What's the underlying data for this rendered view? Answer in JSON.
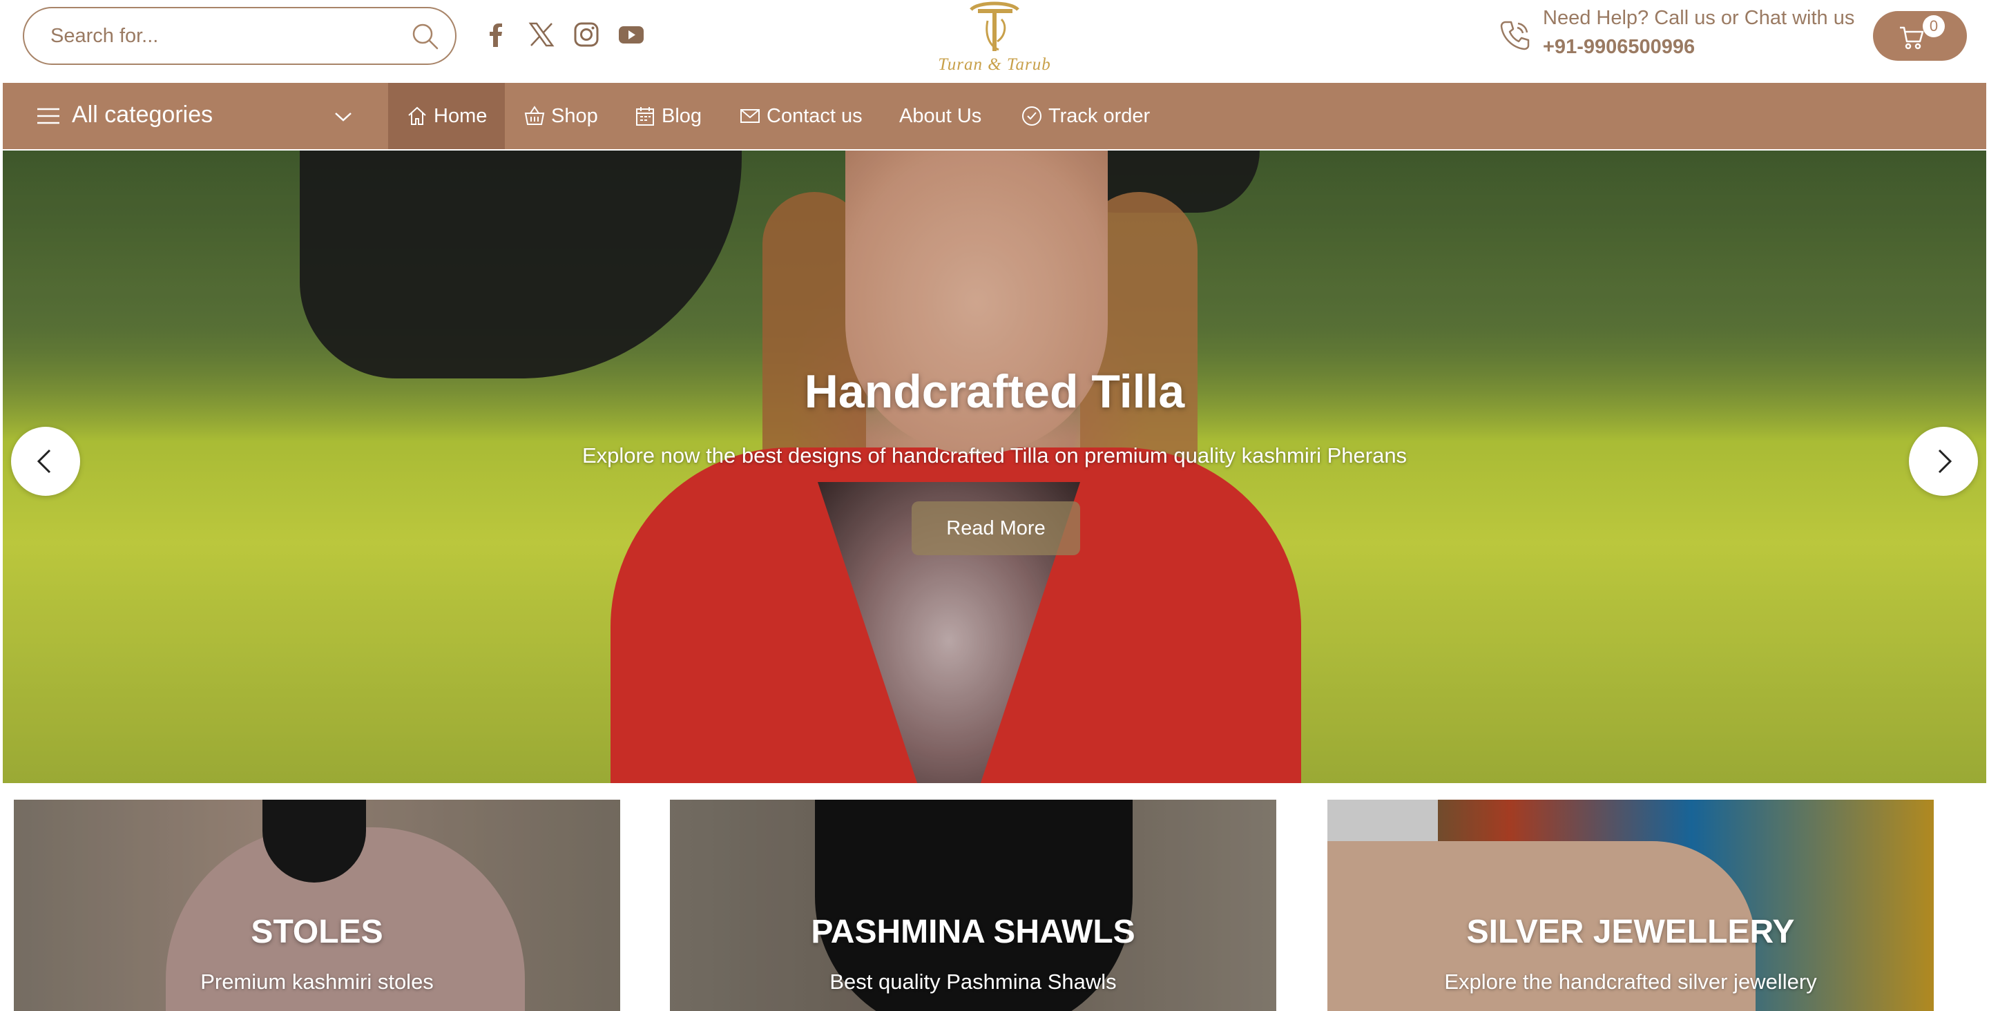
{
  "search": {
    "placeholder": "Search for..."
  },
  "social": [
    "facebook-icon",
    "x-twitter-icon",
    "instagram-icon",
    "youtube-icon"
  ],
  "logo": {
    "brand": "Turan & Tarub"
  },
  "help": {
    "line1": "Need Help? Call us or Chat with us",
    "phone": "+91-9906500996"
  },
  "cart": {
    "count": "0"
  },
  "nav": {
    "all_categories": "All categories",
    "items": [
      {
        "label": "Home",
        "icon": "home-icon",
        "active": true
      },
      {
        "label": "Shop",
        "icon": "basket-icon"
      },
      {
        "label": "Blog",
        "icon": "calendar-icon"
      },
      {
        "label": "Contact us",
        "icon": "mail-icon"
      },
      {
        "label": "About Us"
      },
      {
        "label": "Track order",
        "icon": "check-circle-icon"
      }
    ]
  },
  "hero": {
    "title": "Handcrafted Tilla",
    "subtitle": "Explore now the best designs of handcrafted Tilla on premium quality kashmiri Pherans",
    "button": "Read More"
  },
  "categories": [
    {
      "title": "STOLES",
      "subtitle": "Premium kashmiri stoles"
    },
    {
      "title": "PASHMINA SHAWLS",
      "subtitle": "Best quality Pashmina Shawls"
    },
    {
      "title": "SILVER JEWELLERY",
      "subtitle": "Explore the handcrafted silver jewellery"
    }
  ],
  "colors": {
    "brand": "#ae7f62",
    "brand_dark": "#96684e",
    "text": "#9a7a62",
    "gold": "#c8a04a"
  }
}
